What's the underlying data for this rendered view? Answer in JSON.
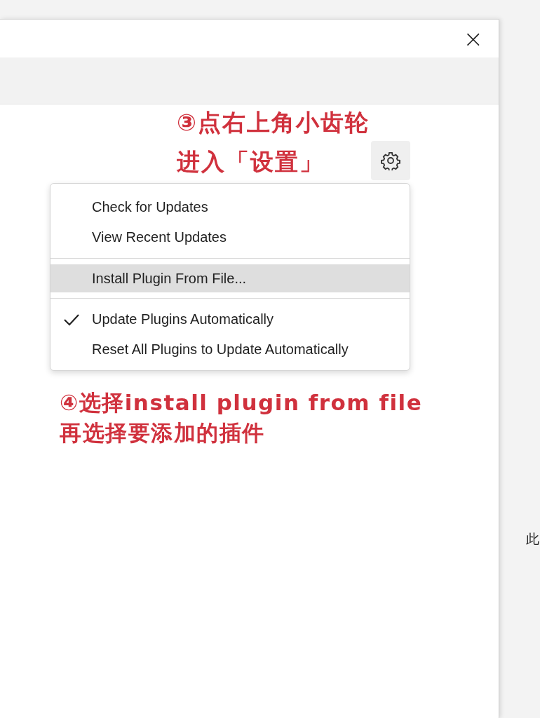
{
  "dialog": {
    "close_glyph": "×"
  },
  "note_3": [
    "③点右上角小齿轮",
    "进入「设置」"
  ],
  "menu": [
    {
      "kind": "item",
      "label": "Check for Updates",
      "checked": false,
      "selected": false
    },
    {
      "kind": "item",
      "label": "View Recent Updates",
      "checked": false,
      "selected": false
    },
    {
      "kind": "separator"
    },
    {
      "kind": "item",
      "label": "Install Plugin From File...",
      "checked": false,
      "selected": true
    },
    {
      "kind": "separator"
    },
    {
      "kind": "item",
      "label": "Update Plugins Automatically",
      "checked": true,
      "selected": false
    },
    {
      "kind": "item",
      "label": "Reset All Plugins to Update Automatically",
      "checked": false,
      "selected": false
    }
  ],
  "note_4": [
    "④选择install plugin from file",
    "再选择要添加的插件"
  ],
  "background_text": "此"
}
